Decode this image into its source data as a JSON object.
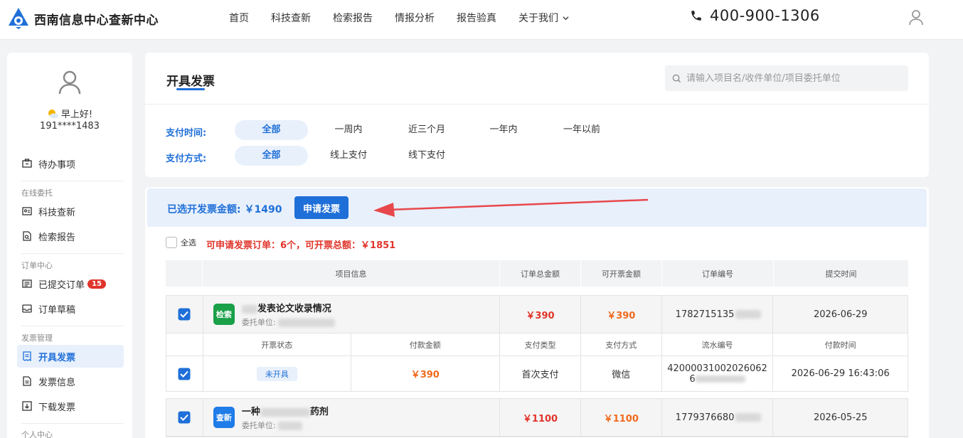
{
  "header": {
    "brand": "西南信息中心查新中心",
    "nav": [
      "首页",
      "科技查新",
      "检索报告",
      "情报分析",
      "报告验真",
      "关于我们"
    ],
    "phone": "400-900-1306"
  },
  "sidebar": {
    "greeting": "早上好!",
    "user_phone": "191****1483",
    "todo": "待办事项",
    "group_online": "在线委托",
    "item_novelty": "科技查新",
    "item_search": "检索报告",
    "group_order": "订单中心",
    "item_submitted": "已提交订单",
    "submitted_count": "15",
    "item_draft": "订单草稿",
    "group_invoice": "发票管理",
    "item_issue": "开具发票",
    "item_invoice_info": "发票信息",
    "item_download": "下载发票",
    "group_personal": "个人中心"
  },
  "head": {
    "title": "开具发票",
    "search_placeholder": "请输入项目名/收件单位/项目委托单位",
    "pay_time_label": "支付时间:",
    "pay_time_options": [
      "全部",
      "一周内",
      "近三个月",
      "一年内",
      "一年以前"
    ],
    "pay_method_label": "支付方式:",
    "pay_method_options": [
      "全部",
      "线上支付",
      "线下支付"
    ]
  },
  "list": {
    "selected_amount": "已选开发票金额: ￥1490",
    "apply_button": "申请发票",
    "select_all": "全选",
    "summary": "可申请发票订单：6个，可开票总额：￥1851",
    "columns": [
      "项目信息",
      "订单总金额",
      "可开票金额",
      "订单编号",
      "提交时间"
    ],
    "sub_columns": [
      "开票状态",
      "付款金额",
      "支付类型",
      "支付方式",
      "流水编号",
      "付款时间"
    ],
    "orders": [
      {
        "tag": "检索",
        "title_suffix": "发表论文收录情况",
        "client_label": "委托单位:",
        "total": "￥390",
        "invoiceable": "￥390",
        "order_no": "1782715135",
        "submit_date": "2026-06-29",
        "payment": {
          "status": "未开具",
          "amount": "￥390",
          "pay_type": "首次支付",
          "pay_method": "微信",
          "serial": "42000031002026062",
          "serial_line2": "6",
          "pay_time": "2026-06-29 16:43:06"
        }
      },
      {
        "tag": "查新",
        "title_prefix": "一种",
        "title_suffix": "药剂",
        "client_label": "委托单位:",
        "total": "￥1100",
        "invoiceable": "￥1100",
        "order_no": "1779376680",
        "submit_date": "2026-05-25"
      }
    ]
  },
  "colors": {
    "primary": "#1f6fd8",
    "danger": "#e0352b",
    "orange": "#f06a1e",
    "green_tag": "#19a048",
    "arrow": "#e8484c"
  }
}
